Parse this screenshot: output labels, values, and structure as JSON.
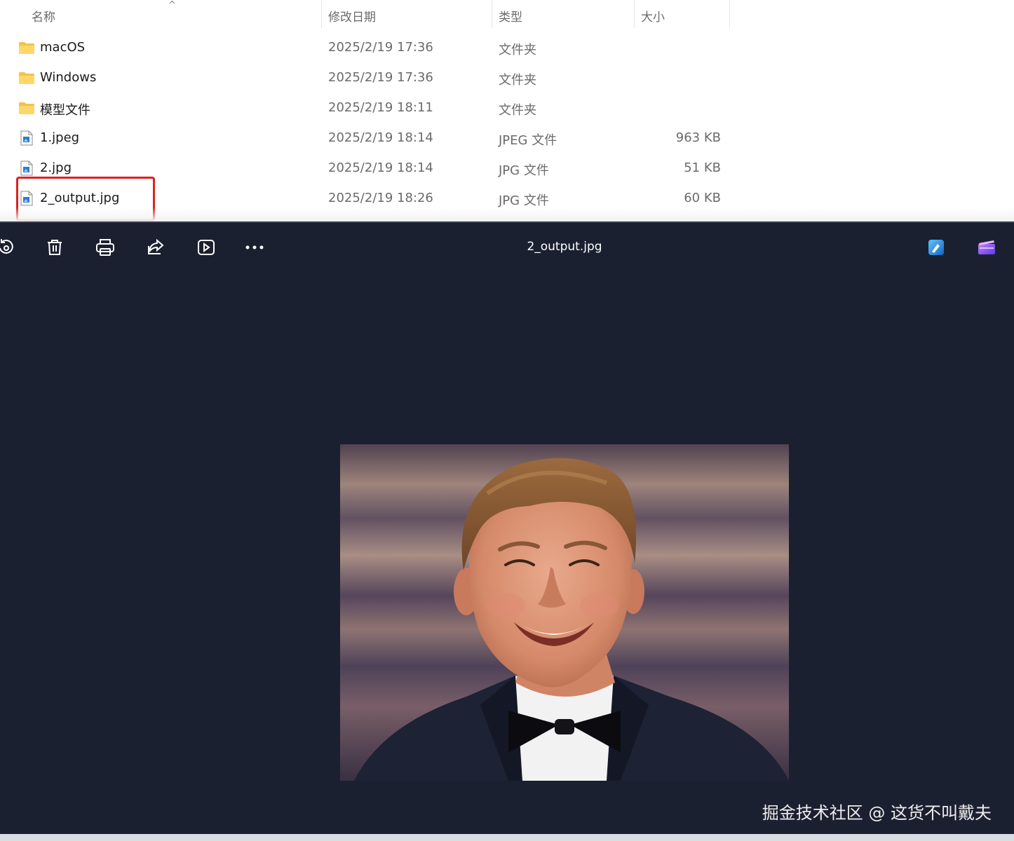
{
  "explorer": {
    "columns": {
      "name": "名称",
      "date": "修改日期",
      "type": "类型",
      "size": "大小"
    },
    "files": [
      {
        "name": "macOS",
        "date": "2025/2/19 17:36",
        "type": "文件夹",
        "size": "",
        "kind": "folder"
      },
      {
        "name": "Windows",
        "date": "2025/2/19 17:36",
        "type": "文件夹",
        "size": "",
        "kind": "folder"
      },
      {
        "name": "模型文件",
        "date": "2025/2/19 18:11",
        "type": "文件夹",
        "size": "",
        "kind": "folder"
      },
      {
        "name": "1.jpeg",
        "date": "2025/2/19 18:14",
        "type": "JPEG 文件",
        "size": "963 KB",
        "kind": "image"
      },
      {
        "name": "2.jpg",
        "date": "2025/2/19 18:14",
        "type": "JPG 文件",
        "size": "51 KB",
        "kind": "image"
      },
      {
        "name": "2_output.jpg",
        "date": "2025/2/19 18:26",
        "type": "JPG 文件",
        "size": "60 KB",
        "kind": "image"
      }
    ],
    "highlight_color": "#e02020"
  },
  "viewer": {
    "title": "2_output.jpg",
    "toolbar_icons": [
      "rotate-icon",
      "delete-icon",
      "print-icon",
      "share-icon",
      "slideshow-icon",
      "more-icon",
      "edit-photo-icon",
      "clipchamp-icon"
    ],
    "background": "#1b2030"
  },
  "watermark": "掘金技术社区 @ 这货不叫戴夫"
}
